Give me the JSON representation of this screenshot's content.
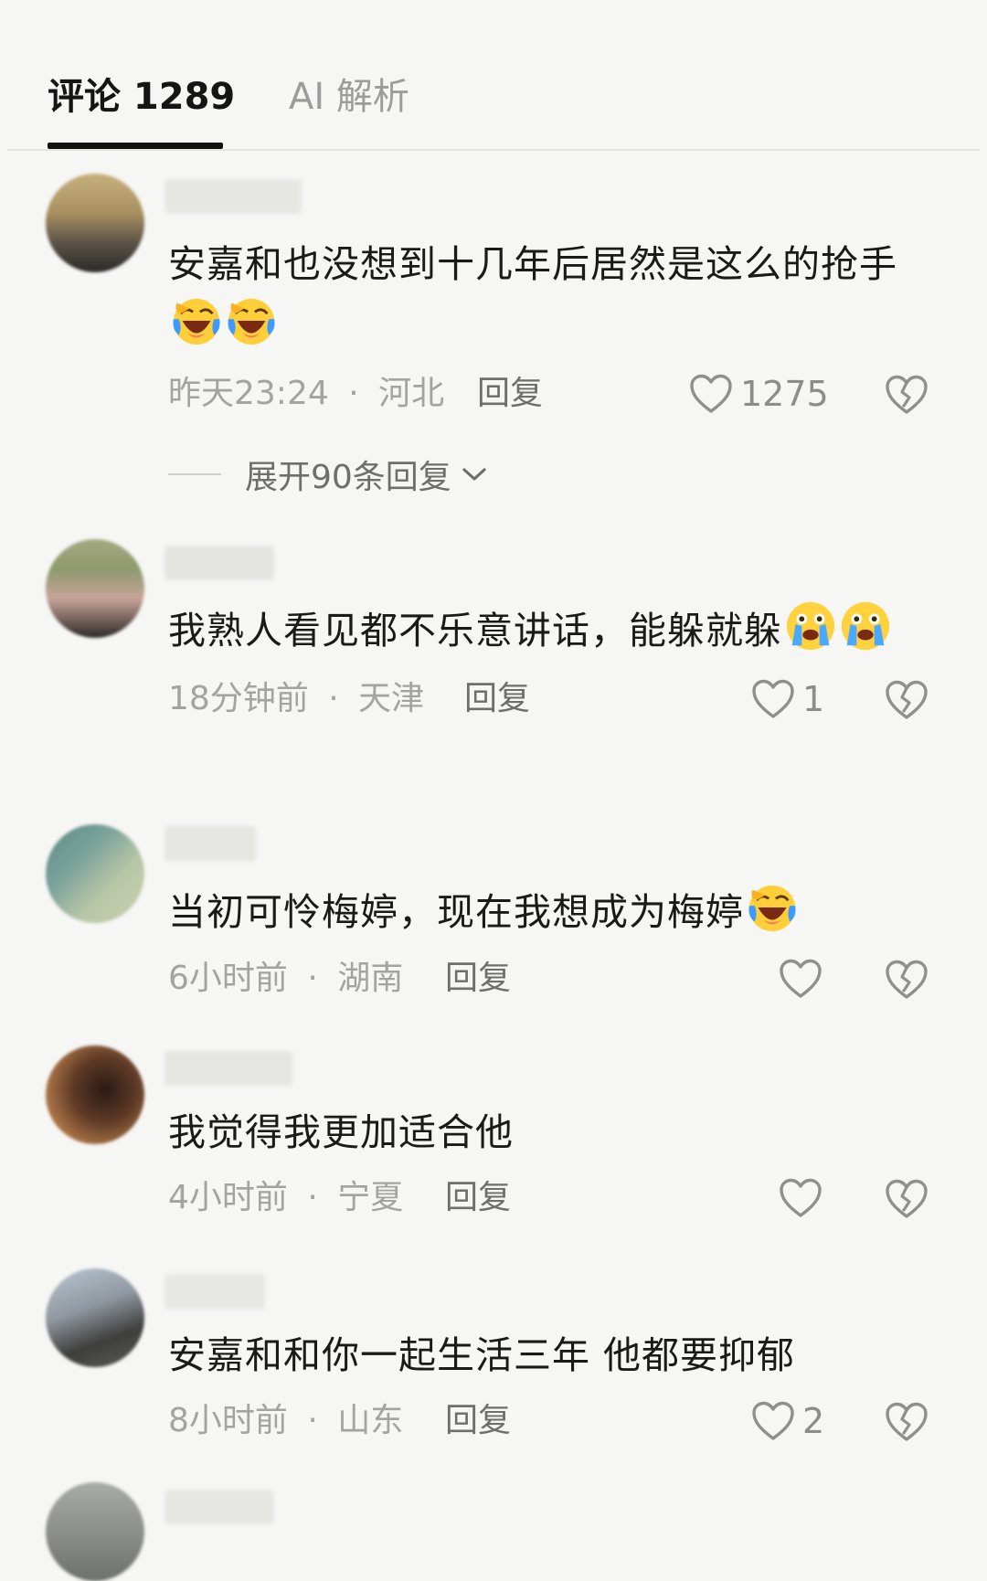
{
  "tabs": {
    "comments_label": "评论 1289",
    "ai_label": "AI 解析"
  },
  "comments": [
    {
      "text": "安嘉和也没想到十几年后居然是这么的抢手",
      "emoji": [
        "crying-laughing-emoji-icon",
        "crying-laughing-emoji-icon"
      ],
      "time": "昨天23:24",
      "separator": "·",
      "location": "河北",
      "reply_label": "回复",
      "likes": "1275",
      "expand_label": "展开90条回复"
    },
    {
      "text": "我熟人看见都不乐意讲话，能躲就躲",
      "emoji": [
        "sobbing-emoji-icon",
        "sobbing-emoji-icon"
      ],
      "time": "18分钟前",
      "separator": "·",
      "location": "天津",
      "reply_label": "回复",
      "likes": "1"
    },
    {
      "text": "当初可怜梅婷，现在我想成为梅婷",
      "emoji": [
        "crying-laughing-emoji-icon"
      ],
      "time": "6小时前",
      "separator": "·",
      "location": "湖南",
      "reply_label": "回复",
      "likes": ""
    },
    {
      "text": "我觉得我更加适合他",
      "emoji": [],
      "time": "4小时前",
      "separator": "·",
      "location": "宁夏",
      "reply_label": "回复",
      "likes": ""
    },
    {
      "text": "安嘉和和你一起生活三年 他都要抑郁",
      "emoji": [],
      "time": "8小时前",
      "separator": "·",
      "location": "山东",
      "reply_label": "回复",
      "likes": "2"
    }
  ],
  "colors": {
    "background": "#f6f6f4",
    "text": "#1a1a1a",
    "meta": "#a3a3a3",
    "active_tab": "#151515",
    "inactive_tab": "#9c9c9c"
  }
}
